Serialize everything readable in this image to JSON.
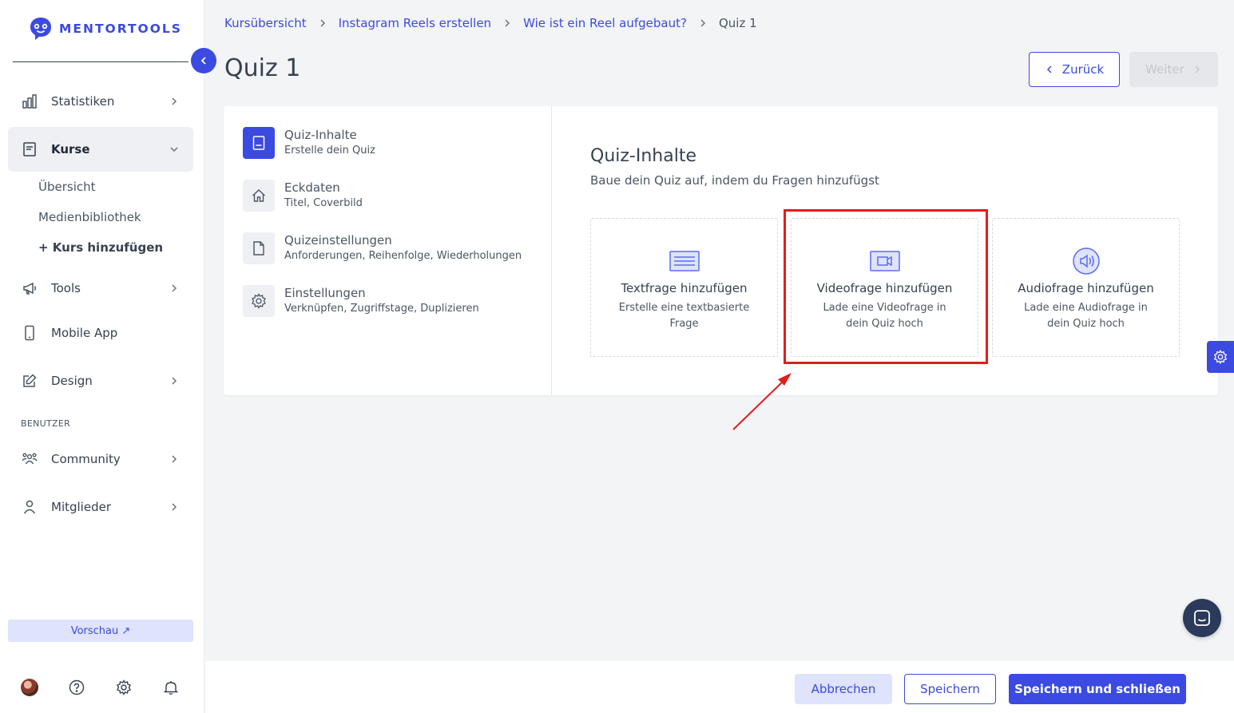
{
  "brand": {
    "name": "MENTORTOOLS",
    "accent": "#3b4ae0"
  },
  "sidebar": {
    "items": [
      {
        "label": "Statistiken",
        "icon": "bar-chart-icon"
      },
      {
        "label": "Kurse",
        "icon": "book-icon",
        "expanded": true
      },
      {
        "label": "Tools",
        "icon": "megaphone-icon"
      },
      {
        "label": "Mobile App",
        "icon": "phone-icon"
      },
      {
        "label": "Design",
        "icon": "pencil-icon"
      },
      {
        "label": "Community",
        "icon": "users-icon"
      },
      {
        "label": "Mitglieder",
        "icon": "user-icon"
      }
    ],
    "sub_items": [
      "Übersicht",
      "Medienbibliothek",
      "+ Kurs hinzufügen"
    ],
    "section_label": "BENUTZER",
    "preview_label": "Vorschau ↗"
  },
  "breadcrumb": [
    "Kursübersicht",
    "Instagram Reels erstellen",
    "Wie ist ein Reel aufgebaut?",
    "Quiz 1"
  ],
  "page_title": "Quiz 1",
  "nav_buttons": {
    "back": "Zurück",
    "next": "Weiter"
  },
  "steps": [
    {
      "title": "Quiz-Inhalte",
      "sub": "Erstelle dein Quiz"
    },
    {
      "title": "Eckdaten",
      "sub": "Titel, Coverbild"
    },
    {
      "title": "Quizeinstellungen",
      "sub": "Anforderungen, Reihenfolge, Wiederholungen"
    },
    {
      "title": "Einstellungen",
      "sub": "Verknüpfen, Zugriffstage, Duplizieren"
    }
  ],
  "content": {
    "title": "Quiz-Inhalte",
    "subtitle": "Baue dein Quiz auf, indem du Fragen hinzufügst",
    "options": [
      {
        "title": "Textfrage hinzufügen",
        "desc": "Erstelle eine textbasierte Frage"
      },
      {
        "title": "Videofrage hinzufügen",
        "desc": "Lade eine Videofrage in dein Quiz hoch"
      },
      {
        "title": "Audiofrage hinzufügen",
        "desc": "Lade eine Audiofrage in dein Quiz hoch"
      }
    ]
  },
  "footer": {
    "cancel": "Abbrechen",
    "save": "Speichern",
    "save_close": "Speichern und schließen"
  }
}
